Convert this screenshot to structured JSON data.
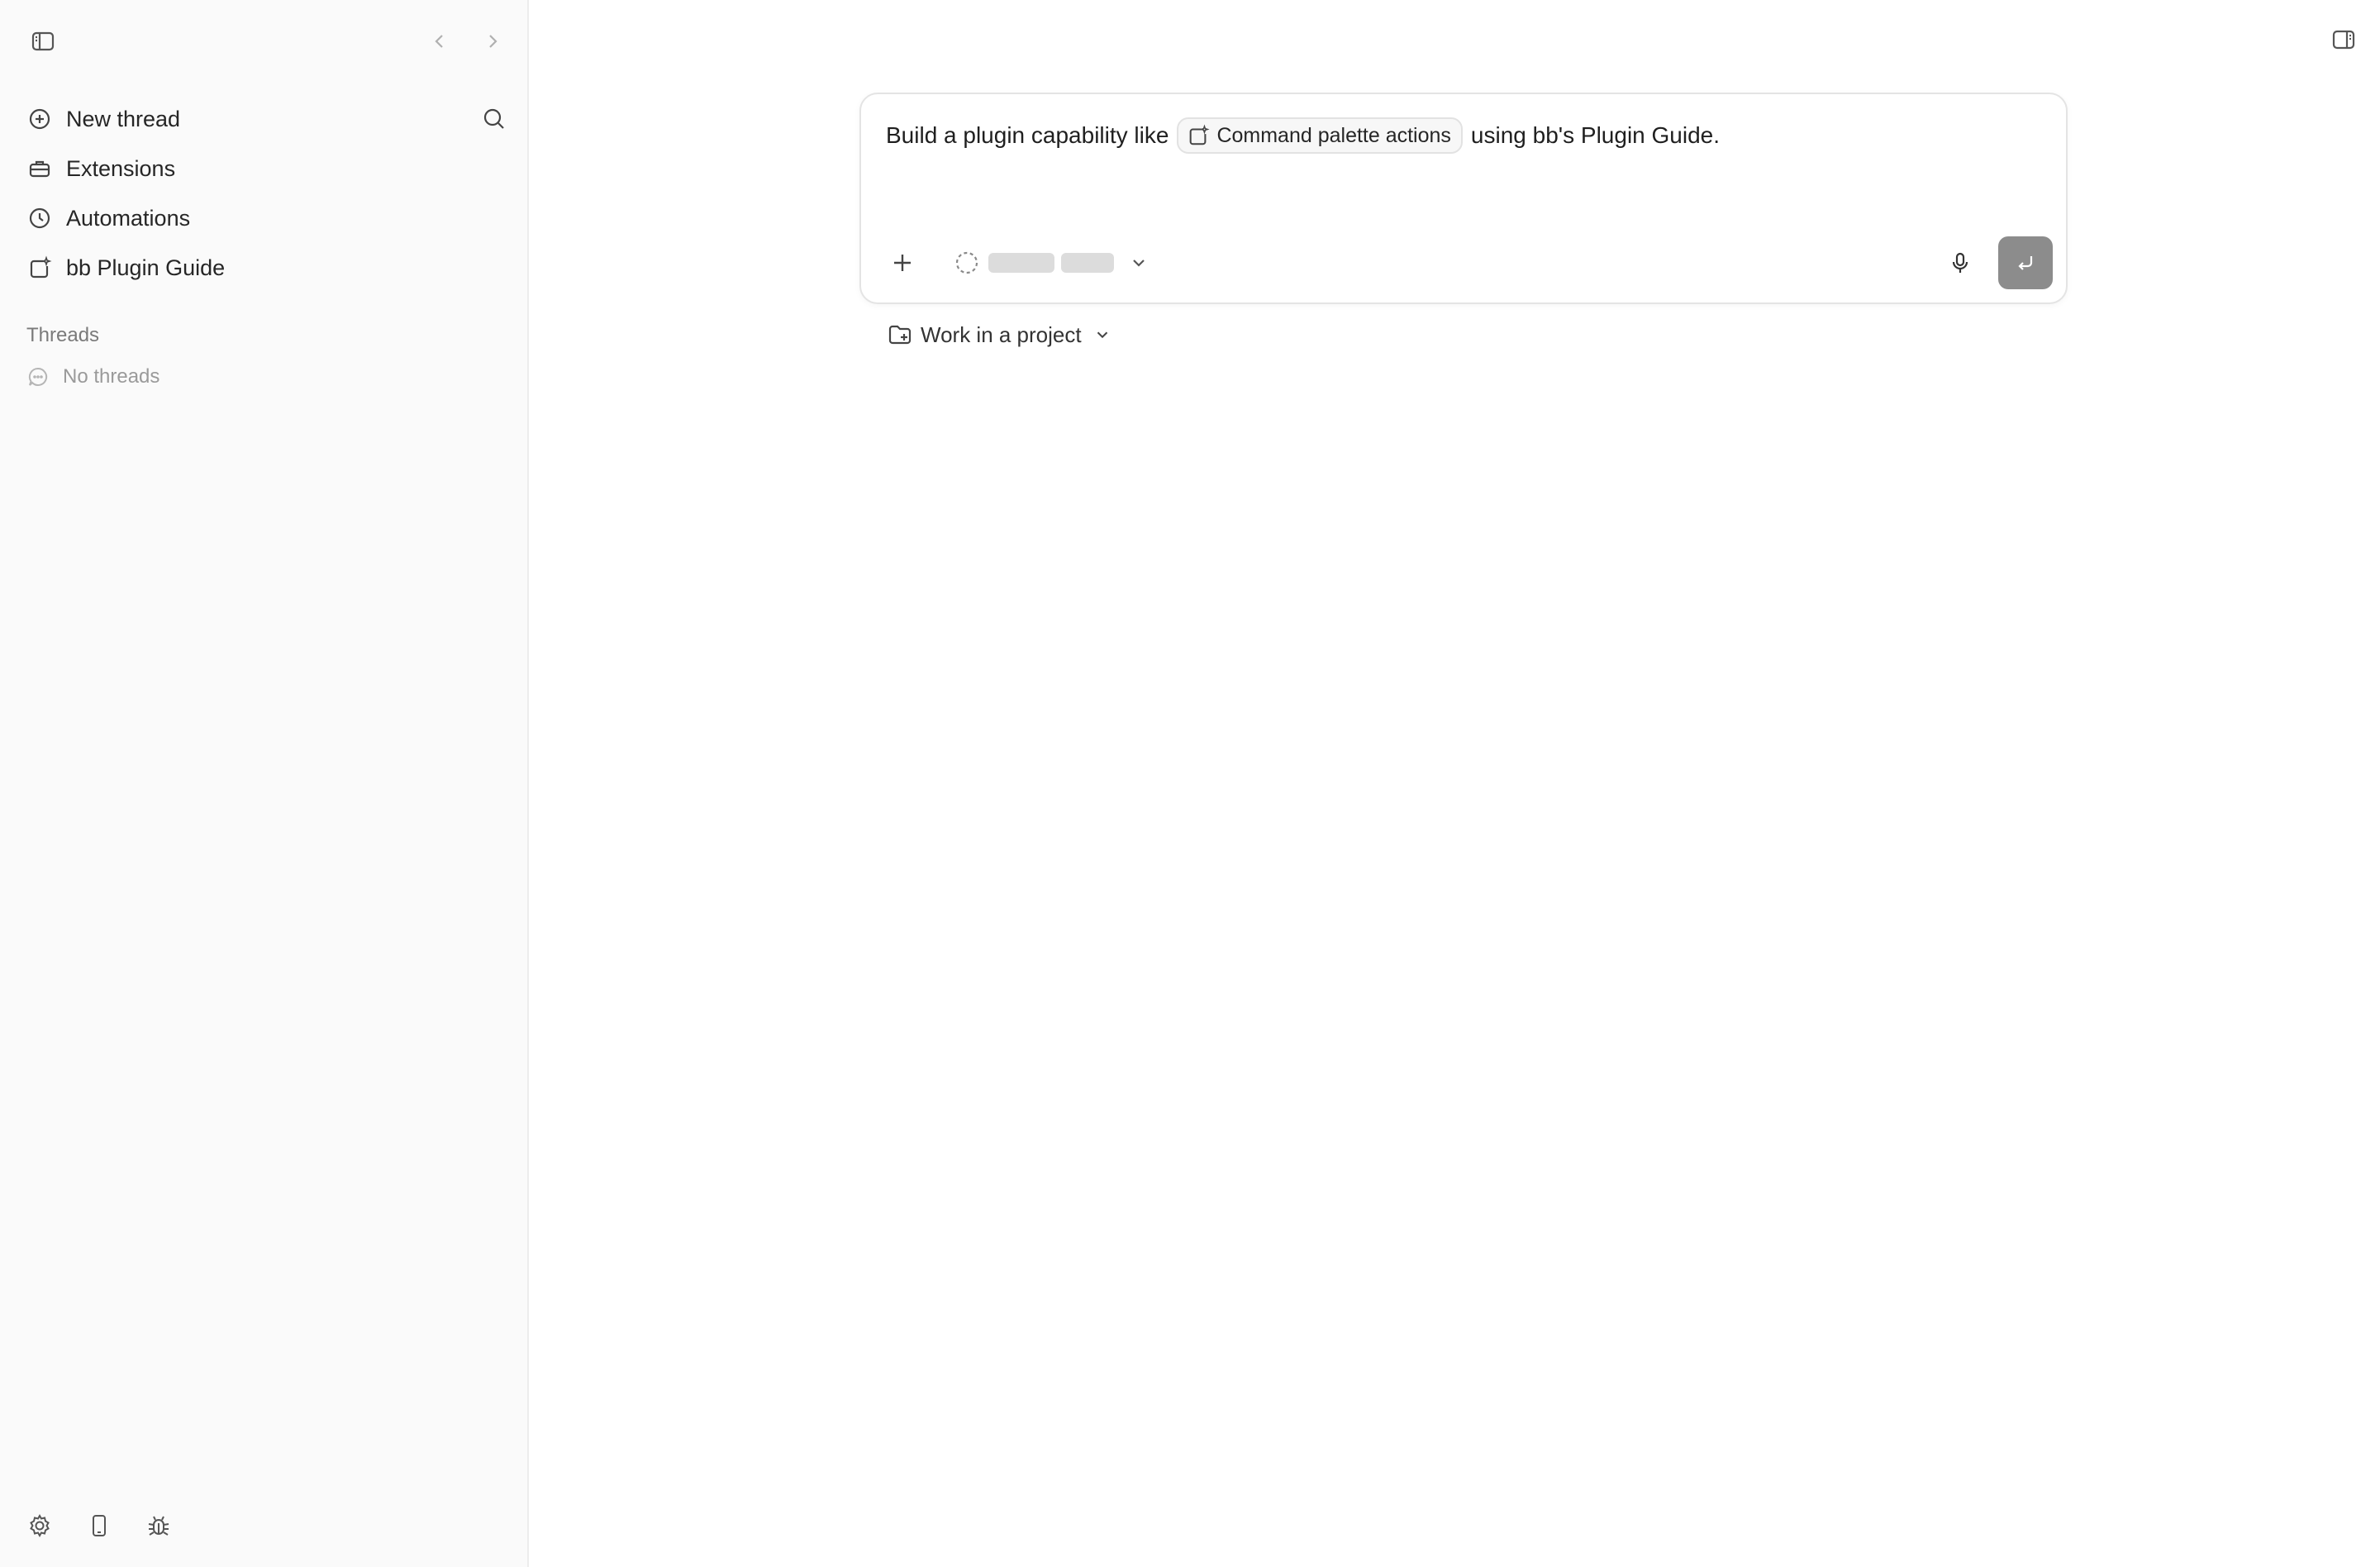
{
  "sidebar": {
    "nav": [
      {
        "label": "New thread",
        "icon": "plus-circle-icon"
      },
      {
        "label": "Extensions",
        "icon": "toolbox-icon"
      },
      {
        "label": "Automations",
        "icon": "clock-icon"
      },
      {
        "label": "bb Plugin Guide",
        "icon": "plugin-sparkle-icon"
      }
    ],
    "threads_heading": "Threads",
    "no_threads": "No threads"
  },
  "composer": {
    "text_before": "Build a plugin capability like",
    "chip_label": "Command palette actions",
    "text_after": "using bb's Plugin Guide."
  },
  "project": {
    "label": "Work in a project"
  },
  "colors": {
    "sidebar_bg": "#fafafa",
    "send_button": "#8c8c8c",
    "skeleton": "#dcdcdc"
  }
}
